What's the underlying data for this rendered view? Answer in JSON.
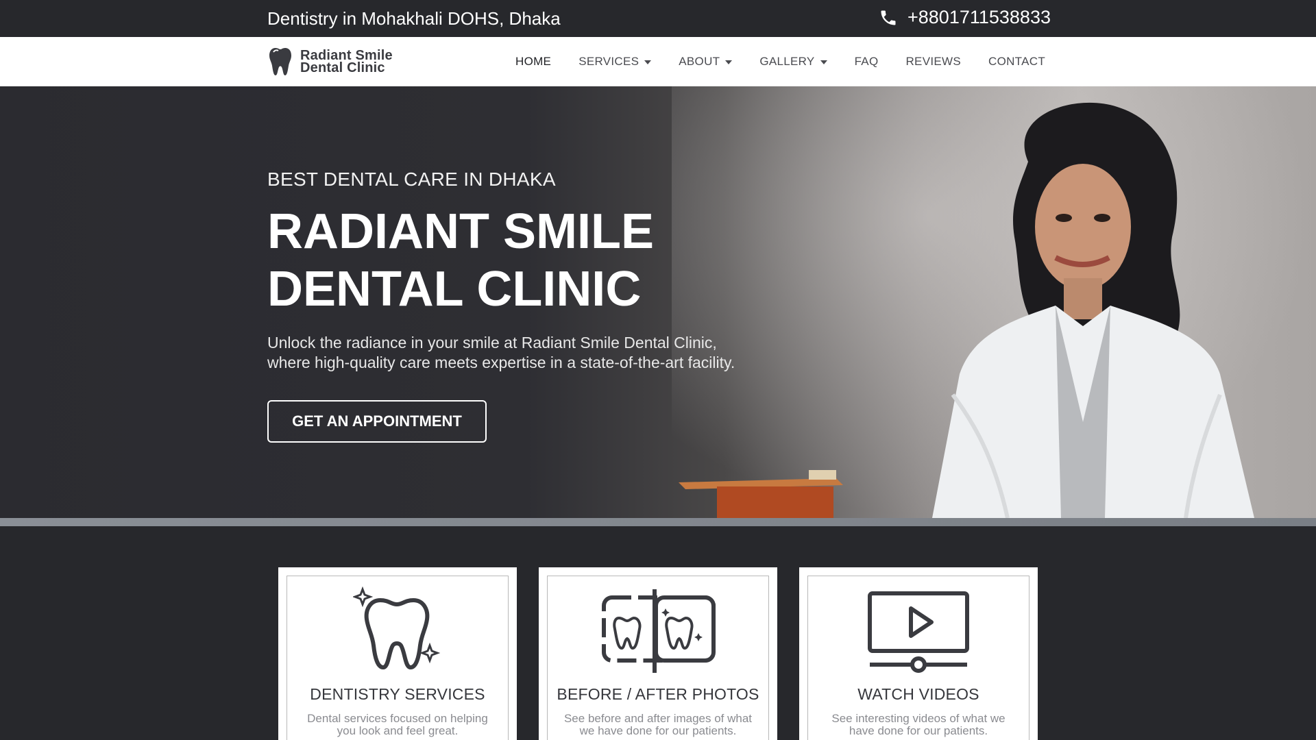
{
  "topbar": {
    "location": "Dentistry in Mohakhali DOHS, Dhaka",
    "phone": "+8801711538833",
    "phone_icon": "phone-icon"
  },
  "header": {
    "logo_line1": "Radiant Smile",
    "logo_line2": "Dental Clinic",
    "nav": [
      {
        "label": "HOME",
        "active": true,
        "dropdown": false
      },
      {
        "label": "SERVICES",
        "active": false,
        "dropdown": true
      },
      {
        "label": "ABOUT",
        "active": false,
        "dropdown": true
      },
      {
        "label": "GALLERY",
        "active": false,
        "dropdown": true
      },
      {
        "label": "FAQ",
        "active": false,
        "dropdown": false
      },
      {
        "label": "REVIEWS",
        "active": false,
        "dropdown": false
      },
      {
        "label": "CONTACT",
        "active": false,
        "dropdown": false
      }
    ]
  },
  "hero": {
    "kicker": "BEST DENTAL CARE IN DHAKA",
    "title_line1": "RADIANT SMILE",
    "title_line2": "DENTAL CLINIC",
    "desc_line1": "Unlock the radiance in your smile at Radiant Smile Dental Clinic,",
    "desc_line2": "where high-quality care meets expertise in a state-of-the-art facility.",
    "cta": "GET AN APPOINTMENT"
  },
  "cards": [
    {
      "title": "DENTISTRY SERVICES",
      "text_line1": "Dental services focused on helping",
      "text_line2": "you look and feel great.",
      "icon": "tooth-sparkle-icon"
    },
    {
      "title": "BEFORE / AFTER PHOTOS",
      "text_line1": "See before and after images of what",
      "text_line2": "we have done for our patients.",
      "icon": "before-after-icon"
    },
    {
      "title": "WATCH VIDEOS",
      "text_line1": "See interesting videos of what we",
      "text_line2": "have done for our patients.",
      "icon": "video-play-icon"
    }
  ],
  "colors": {
    "dark_bg": "#27282c",
    "white": "#ffffff",
    "nav_text": "#4a4b50",
    "card_title": "#35363b"
  }
}
